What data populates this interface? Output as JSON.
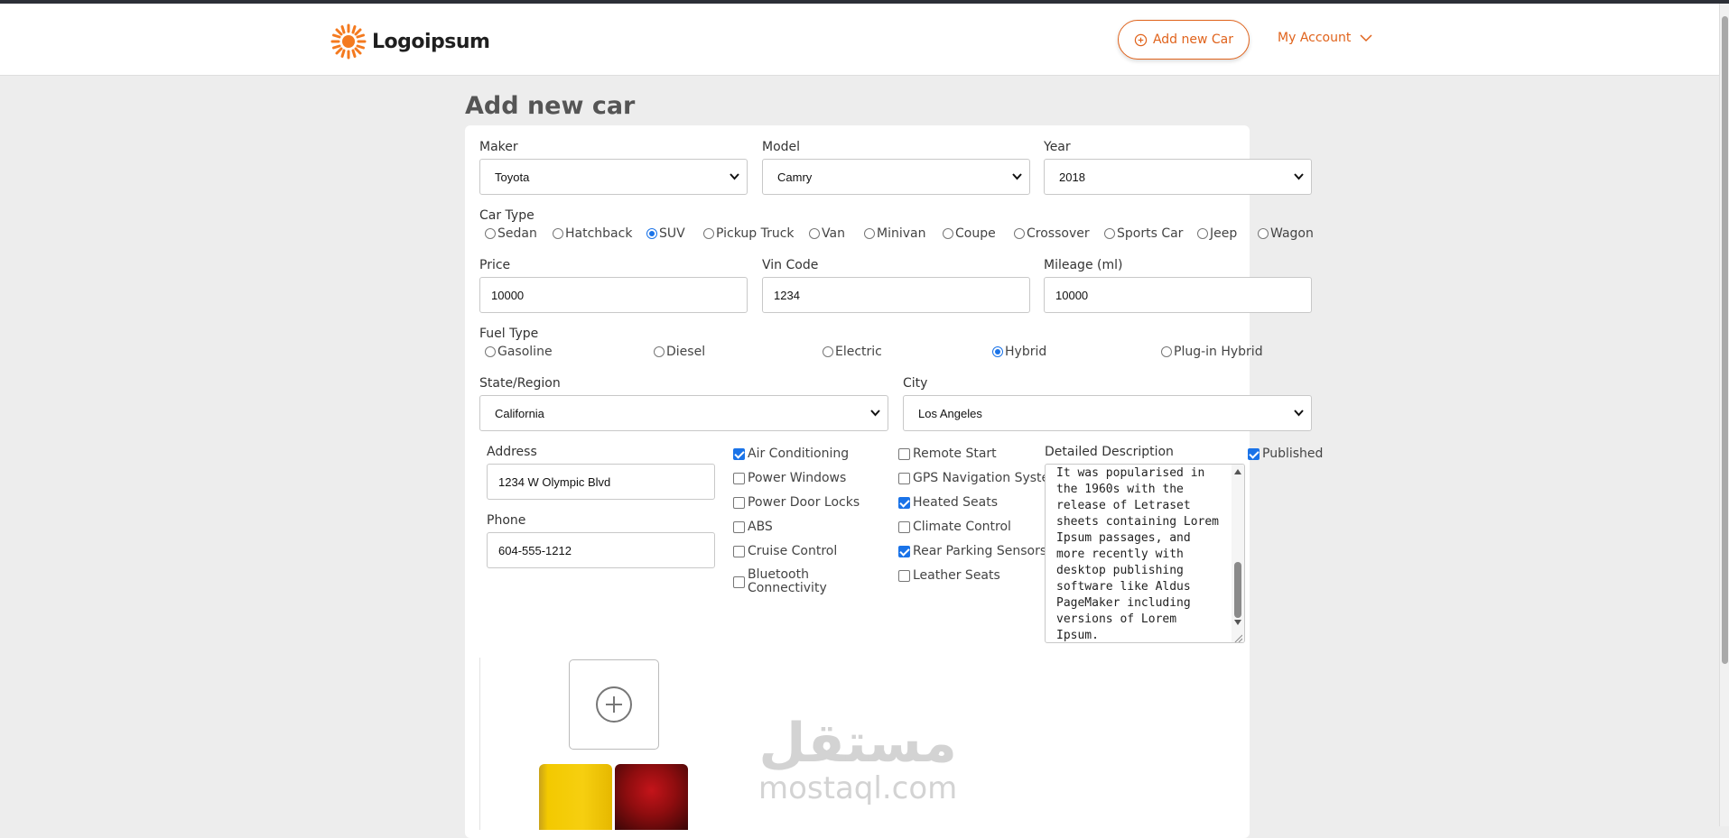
{
  "header": {
    "logo_text": "Logoipsum",
    "add_car_label": "Add new Car",
    "account_label": "My Account",
    "brand_color": "#e0631c"
  },
  "page_title": "Add new car",
  "form": {
    "maker": {
      "label": "Maker",
      "value": "Toyota"
    },
    "model": {
      "label": "Model",
      "value": "Camry"
    },
    "year": {
      "label": "Year",
      "value": "2018"
    },
    "car_type": {
      "label": "Car Type",
      "options": [
        "Sedan",
        "Hatchback",
        "SUV",
        "Pickup Truck",
        "Van",
        "Minivan",
        "Coupe",
        "Crossover",
        "Sports Car",
        "Jeep",
        "Wagon"
      ],
      "selected": "SUV"
    },
    "price": {
      "label": "Price",
      "value": "10000"
    },
    "vin": {
      "label": "Vin Code",
      "value": "1234"
    },
    "mileage": {
      "label": "Mileage (ml)",
      "value": "10000"
    },
    "fuel_type": {
      "label": "Fuel Type",
      "options": [
        "Gasoline",
        "Diesel",
        "Electric",
        "Hybrid",
        "Plug-in Hybrid"
      ],
      "selected": "Hybrid"
    },
    "state": {
      "label": "State/Region",
      "value": "California"
    },
    "city": {
      "label": "City",
      "value": "Los Angeles"
    },
    "address": {
      "label": "Address",
      "value": "1234 W Olympic Blvd"
    },
    "phone": {
      "label": "Phone",
      "value": "604-555-1212"
    },
    "features_col1": [
      {
        "label": "Air Conditioning",
        "checked": true
      },
      {
        "label": "Power Windows",
        "checked": false
      },
      {
        "label": "Power Door Locks",
        "checked": false
      },
      {
        "label": "ABS",
        "checked": false
      },
      {
        "label": "Cruise Control",
        "checked": false
      },
      {
        "label": "Bluetooth Connectivity",
        "checked": false
      }
    ],
    "features_col2": [
      {
        "label": "Remote Start",
        "checked": false
      },
      {
        "label": "GPS Navigation System",
        "checked": false
      },
      {
        "label": "Heated Seats",
        "checked": true
      },
      {
        "label": "Climate Control",
        "checked": false
      },
      {
        "label": "Rear Parking Sensors",
        "checked": true
      },
      {
        "label": "Leather Seats",
        "checked": false
      }
    ],
    "description": {
      "label": "Detailed Description",
      "value": "It was popularised in the 1960s with the release of Letraset sheets containing Lorem Ipsum passages, and more recently with desktop publishing software like Aldus PageMaker including versions of Lorem Ipsum."
    },
    "published": {
      "label": "Published",
      "checked": true
    }
  },
  "watermark": {
    "arabic": "مستقل",
    "latin": "mostaql.com"
  }
}
